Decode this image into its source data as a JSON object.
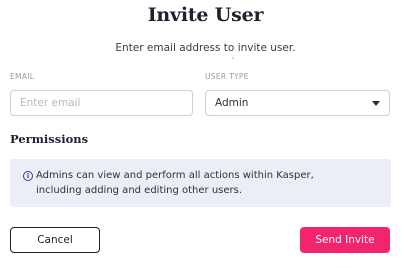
{
  "dialog": {
    "title": "Invite User",
    "subtitle": "Enter email address to invite user."
  },
  "form": {
    "email_label": "EMAIL",
    "email_placeholder": "Enter email",
    "email_value": "",
    "user_type_label": "USER TYPE",
    "user_type_value": "Admin"
  },
  "permissions": {
    "heading": "Permissions",
    "info_icon": "info-icon",
    "info_text_line1": "Admins can view and perform all actions within Kasper,",
    "info_text_line2": "including adding and editing other users."
  },
  "actions": {
    "cancel_label": "Cancel",
    "send_label": "Send Invite"
  },
  "colors": {
    "accent": "#f2246d",
    "info_bg": "#eceef7",
    "info_icon": "#3b3f8f"
  }
}
